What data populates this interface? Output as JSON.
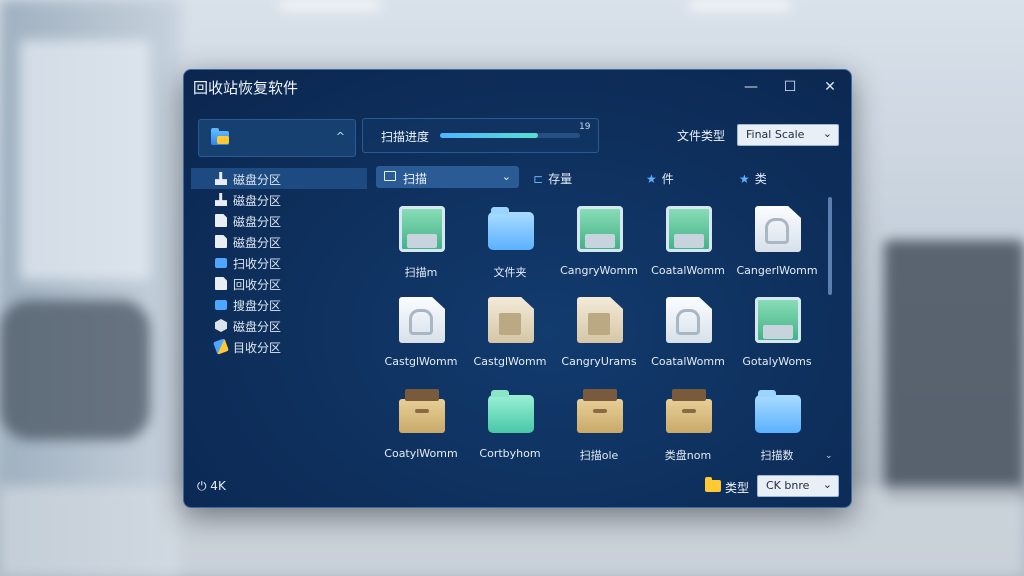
{
  "window": {
    "title": "回收站恢复软件"
  },
  "controls": {
    "minimize": "—",
    "maximize": "☐",
    "close": "✕"
  },
  "sidebar": {
    "drive_select_chevron": "^",
    "items": [
      {
        "label": "磁盘分区",
        "icon": "drive-icon",
        "selected": true
      },
      {
        "label": "磁盘分区",
        "icon": "drive-icon"
      },
      {
        "label": "磁盘分区",
        "icon": "document-icon"
      },
      {
        "label": "磁盘分区",
        "icon": "document-icon"
      },
      {
        "label": "扫收分区",
        "icon": "folder-icon"
      },
      {
        "label": "回收分区",
        "icon": "document-icon"
      },
      {
        "label": "搜盘分区",
        "icon": "folder-icon"
      },
      {
        "label": "磁盘分区",
        "icon": "hexagon-icon"
      },
      {
        "label": "目收分区",
        "icon": "usb-icon"
      }
    ]
  },
  "scan": {
    "label": "扫描进度",
    "progress": 0.7,
    "progress_text": "19"
  },
  "filter": {
    "label": "文件类型",
    "value": "Final Scale",
    "arrow": "⌄"
  },
  "toolbar": {
    "view_select": "扫描",
    "view_arrow": "⌄",
    "btn_folder": "存量",
    "btn_star1": "件",
    "btn_star2": "类"
  },
  "files": [
    {
      "name": "扫描m",
      "icon": "green-doc"
    },
    {
      "name": "文件夹",
      "icon": "blue-folder"
    },
    {
      "name": "CangryWomm",
      "icon": "green-doc"
    },
    {
      "name": "CoatalWomm",
      "icon": "green-doc"
    },
    {
      "name": "CangerlWomm",
      "icon": "white-doc"
    },
    {
      "name": "CastglWomm",
      "icon": "white-doc"
    },
    {
      "name": "CastglWomm",
      "icon": "beige-doc"
    },
    {
      "name": "CangryUrams",
      "icon": "beige-doc"
    },
    {
      "name": "CoatalWomm",
      "icon": "white-doc"
    },
    {
      "name": "GotalyWoms",
      "icon": "green-doc"
    },
    {
      "name": "CoatylWomm",
      "icon": "box"
    },
    {
      "name": "Cortbyhom",
      "icon": "teal-folder"
    },
    {
      "name": "扫描ole",
      "icon": "box"
    },
    {
      "name": "类盘nom",
      "icon": "box"
    },
    {
      "name": "扫描数",
      "icon": "blue-folder"
    }
  ],
  "status": {
    "power_text": "⏻ 4K",
    "type_label": "类型",
    "type_value": "CK bnre",
    "type_arrow": "⌄"
  },
  "scroll": {
    "down_arrow": "⌄"
  }
}
